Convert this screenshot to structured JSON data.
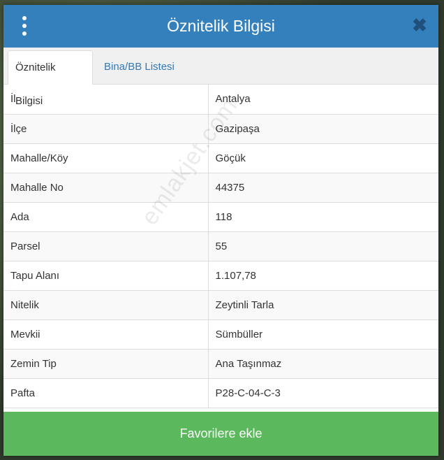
{
  "header": {
    "title": "Öznitelik Bilgisi",
    "menu_icon": "kebab-menu-icon",
    "close_icon": "close-icon",
    "close_glyph": "✖"
  },
  "tabs": [
    {
      "label": "Öznitelik Bilgisi",
      "active": true
    },
    {
      "label": "Bina/BB Listesi",
      "active": false
    }
  ],
  "rows": [
    {
      "key": "İl",
      "value": "Antalya"
    },
    {
      "key": "İlçe",
      "value": "Gazipaşa"
    },
    {
      "key": "Mahalle/Köy",
      "value": "Göçük"
    },
    {
      "key": "Mahalle No",
      "value": "44375"
    },
    {
      "key": "Ada",
      "value": "118"
    },
    {
      "key": "Parsel",
      "value": "55"
    },
    {
      "key": "Tapu Alanı",
      "value": "1.107,78"
    },
    {
      "key": "Nitelik",
      "value": "Zeytinli Tarla"
    },
    {
      "key": "Mevkii",
      "value": "Sümbüller"
    },
    {
      "key": "Zemin Tip",
      "value": "Ana Taşınmaz"
    },
    {
      "key": "Pafta",
      "value": "P28-C-04-C-3"
    }
  ],
  "footer": {
    "button_label": "Favorilere ekle"
  },
  "watermark": "emlakjet.com",
  "colors": {
    "header_bg": "#3380bd",
    "footer_bg": "#5cb85c",
    "tab_link": "#3479b7"
  }
}
